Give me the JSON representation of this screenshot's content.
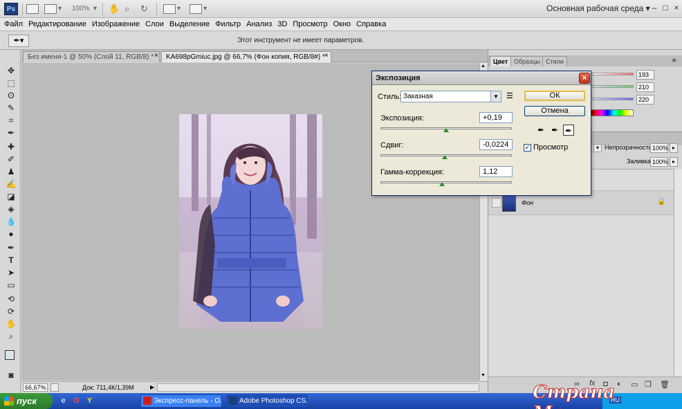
{
  "app": {
    "logo": "Ps",
    "zoom_display": "100%",
    "workspace": "Основная рабочая среда",
    "window_controls": [
      "–",
      "□",
      "×"
    ]
  },
  "menu": [
    "Файл",
    "Редактирование",
    "Изображение",
    "Слои",
    "Выделение",
    "Фильтр",
    "Анализ",
    "3D",
    "Просмотр",
    "Окно",
    "Справка"
  ],
  "options_bar": {
    "message": "Этот инструмент не имеет параметров."
  },
  "tabs": [
    {
      "label": "Без имени-1 @ 50% (Слой 11, RGB/8) *",
      "close": "×"
    },
    {
      "label": "KA698pGmiuc.jpg @ 66,7% (Фон копия, RGB/8#) *",
      "close": "×"
    }
  ],
  "status": {
    "zoom": "66,67%",
    "doc": "Док: 711,4К/1,39М"
  },
  "panels": {
    "color_tabs": [
      "Цвет",
      "Образцы",
      "Стили"
    ],
    "color_values": [
      "193",
      "210",
      "220"
    ],
    "opacity_label": "Непрозрачность:",
    "opacity_value": "100%",
    "fill_label": "Заливка:",
    "fill_value": "100%",
    "layer_name": "Фон"
  },
  "dialog": {
    "title": "Экспозиция",
    "close": "×",
    "style_label": "Стиль:",
    "style_value": "Заказная",
    "exposure_label": "Экспозиция:",
    "exposure_value": "+0,19",
    "exposure_level": 0.5,
    "offset_label": "Сдвиг:",
    "offset_value": "-0,0224",
    "offset_level": 0.49,
    "gamma_label": "Гамма-коррекция:",
    "gamma_value": "1,12",
    "gamma_level": 0.47,
    "ok": "ОК",
    "cancel": "Отмена",
    "preview_label": "Просмотр",
    "preview_checked": "✓"
  },
  "taskbar": {
    "start": "пуск",
    "tasks": [
      {
        "label": "Экспресс-панель - О...",
        "color": "#cc1e1e"
      },
      {
        "label": "Adobe Photoshop CS...",
        "color": "#1c3f7a"
      }
    ],
    "lang": "RU"
  },
  "watermark": "Страна Мам.ру",
  "colors": {
    "accent": "#1c3f7a",
    "taskbar": "#2456c8",
    "dialog_close": "#c2341a"
  }
}
